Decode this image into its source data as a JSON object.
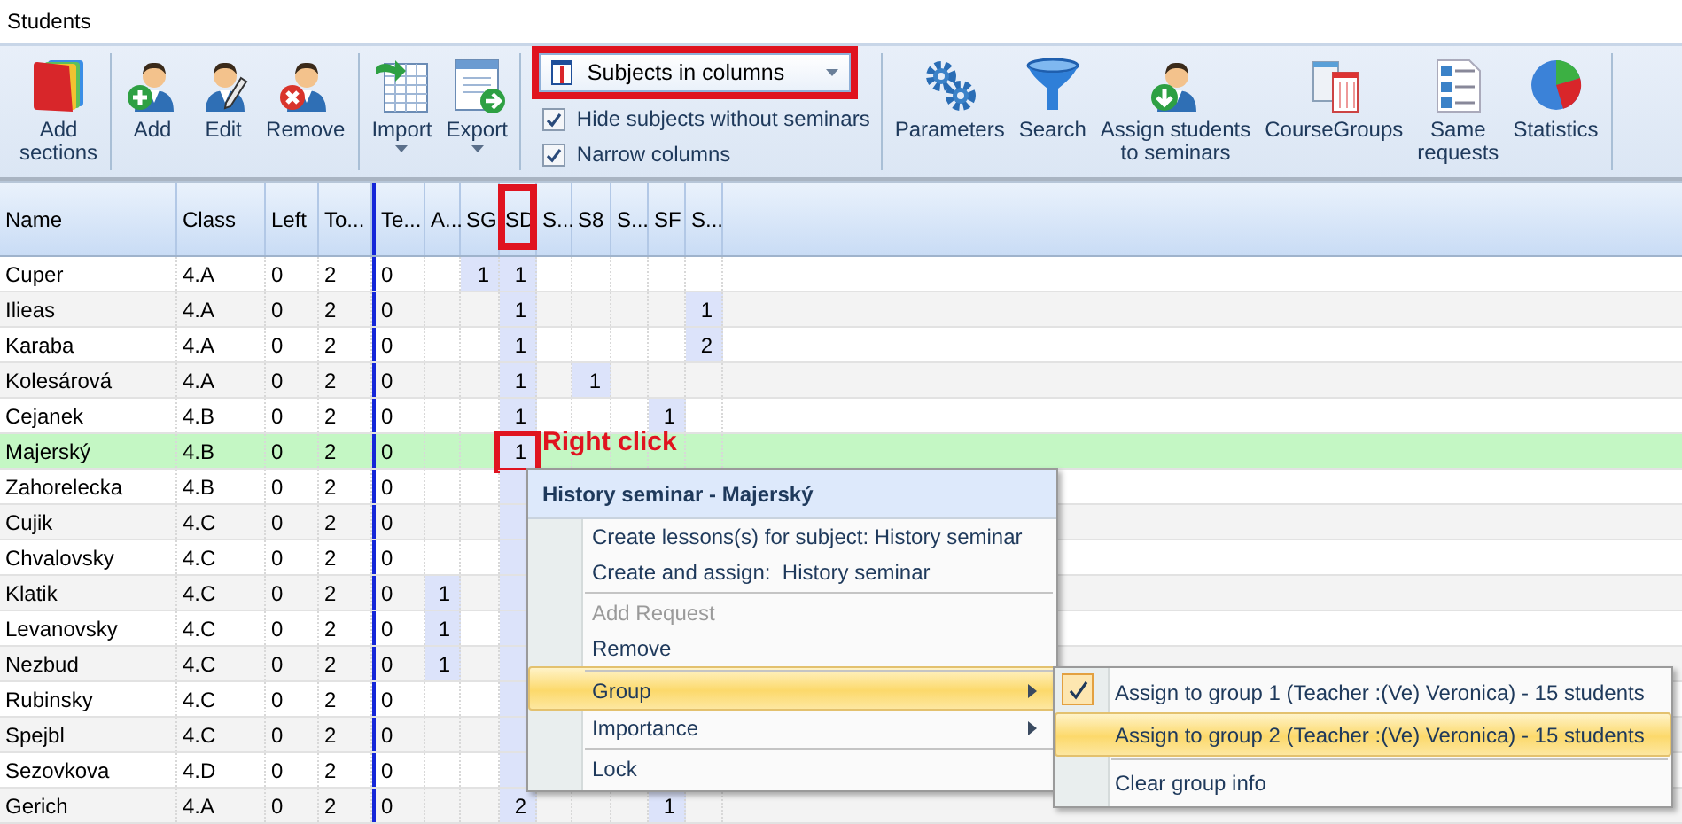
{
  "window": {
    "title": "Students"
  },
  "toolbar": {
    "groups": [
      {
        "buttons": [
          {
            "lines": [
              "Add",
              "sections"
            ],
            "menu": false
          }
        ]
      },
      {
        "buttons": [
          {
            "lines": [
              "Add"
            ],
            "menu": false
          },
          {
            "lines": [
              "Edit"
            ],
            "menu": false
          },
          {
            "lines": [
              "Remove"
            ],
            "menu": false
          }
        ]
      },
      {
        "buttons": [
          {
            "lines": [
              "Import"
            ],
            "menu": true
          },
          {
            "lines": [
              "Export"
            ],
            "menu": true
          }
        ]
      },
      {
        "kind": "view",
        "dropdown": {
          "value": "Subjects in columns",
          "framed": true
        },
        "checkboxes": [
          {
            "label": "Hide subjects without seminars",
            "checked": true
          },
          {
            "label": "Narrow columns",
            "checked": true
          }
        ]
      },
      {
        "buttons": [
          {
            "lines": [
              "Parameters"
            ],
            "menu": false
          },
          {
            "lines": [
              "Search"
            ],
            "menu": false
          },
          {
            "lines": [
              "Assign students",
              "to seminars"
            ],
            "menu": false
          },
          {
            "lines": [
              "CourseGroups"
            ],
            "menu": false
          },
          {
            "lines": [
              "Same",
              "requests"
            ],
            "menu": false
          },
          {
            "lines": [
              "Statistics"
            ],
            "menu": false
          }
        ]
      }
    ]
  },
  "table": {
    "columns": [
      {
        "label": "Name",
        "kind": "info",
        "divider_before": false,
        "selected": false,
        "framed": false
      },
      {
        "label": "Class",
        "kind": "info",
        "divider_before": false,
        "selected": false,
        "framed": false
      },
      {
        "label": "Left",
        "kind": "info",
        "divider_before": false,
        "selected": false,
        "framed": false
      },
      {
        "label": "To...",
        "kind": "info",
        "divider_before": false,
        "selected": false,
        "framed": false
      },
      {
        "label": "Te...",
        "kind": "info",
        "divider_before": true,
        "selected": false,
        "framed": false
      },
      {
        "label": "A...",
        "kind": "seminar",
        "divider_before": false,
        "selected": false,
        "framed": false
      },
      {
        "label": "SG",
        "kind": "seminar",
        "divider_before": false,
        "selected": false,
        "framed": false
      },
      {
        "label": "SD",
        "kind": "seminar",
        "divider_before": false,
        "selected": true,
        "framed": true
      },
      {
        "label": "S...",
        "kind": "seminar",
        "divider_before": false,
        "selected": false,
        "framed": false
      },
      {
        "label": "S8",
        "kind": "seminar",
        "divider_before": false,
        "selected": false,
        "framed": false
      },
      {
        "label": "S...",
        "kind": "seminar",
        "divider_before": false,
        "selected": false,
        "framed": false
      },
      {
        "label": "SF",
        "kind": "seminar",
        "divider_before": false,
        "selected": false,
        "framed": false
      },
      {
        "label": "S...",
        "kind": "seminar",
        "divider_before": false,
        "selected": false,
        "framed": false
      }
    ],
    "rows": [
      {
        "selected": false,
        "framed": false,
        "cells": [
          {
            "text": "Cuper"
          },
          {
            "text": "4.A"
          },
          {
            "text": "0"
          },
          {
            "text": "2"
          },
          {
            "text": "0"
          },
          {},
          {
            "text": "1"
          },
          {
            "text": "1"
          },
          {},
          {},
          {},
          {},
          {}
        ]
      },
      {
        "selected": false,
        "framed": false,
        "cells": [
          {
            "text": "Ilieas"
          },
          {
            "text": "4.A"
          },
          {
            "text": "0"
          },
          {
            "text": "2"
          },
          {
            "text": "0"
          },
          {},
          {},
          {
            "text": "1"
          },
          {},
          {},
          {},
          {},
          {
            "text": "1"
          }
        ]
      },
      {
        "selected": false,
        "framed": false,
        "cells": [
          {
            "text": "Karaba"
          },
          {
            "text": "4.A"
          },
          {
            "text": "0"
          },
          {
            "text": "2"
          },
          {
            "text": "0"
          },
          {},
          {},
          {
            "text": "1"
          },
          {},
          {},
          {},
          {},
          {
            "text": "2"
          }
        ]
      },
      {
        "selected": false,
        "framed": false,
        "cells": [
          {
            "text": "Kolesárová"
          },
          {
            "text": "4.A"
          },
          {
            "text": "0"
          },
          {
            "text": "2"
          },
          {
            "text": "0"
          },
          {},
          {},
          {
            "text": "1"
          },
          {},
          {
            "text": "1"
          },
          {},
          {},
          {}
        ]
      },
      {
        "selected": false,
        "framed": false,
        "cells": [
          {
            "text": "Cejanek"
          },
          {
            "text": "4.B"
          },
          {
            "text": "0"
          },
          {
            "text": "2"
          },
          {
            "text": "0"
          },
          {},
          {},
          {
            "text": "1"
          },
          {},
          {},
          {},
          {
            "text": "1"
          },
          {}
        ]
      },
      {
        "selected": true,
        "framed": true,
        "callout": "Right click",
        "cells": [
          {
            "text": "Majerský"
          },
          {
            "text": "4.B"
          },
          {
            "text": "0"
          },
          {
            "text": "2"
          },
          {
            "text": "0"
          },
          {},
          {},
          {
            "text": "1"
          },
          {},
          {},
          {},
          {},
          {}
        ]
      },
      {
        "selected": false,
        "framed": false,
        "cells": [
          {
            "text": "Zahorelecka"
          },
          {
            "text": "4.B"
          },
          {
            "text": "0"
          },
          {
            "text": "2"
          },
          {
            "text": "0"
          },
          {},
          {},
          {},
          {},
          {},
          {},
          {},
          {}
        ]
      },
      {
        "selected": false,
        "framed": false,
        "cells": [
          {
            "text": "Cujik"
          },
          {
            "text": "4.C"
          },
          {
            "text": "0"
          },
          {
            "text": "2"
          },
          {
            "text": "0"
          },
          {},
          {},
          {},
          {},
          {},
          {},
          {},
          {}
        ]
      },
      {
        "selected": false,
        "framed": false,
        "cells": [
          {
            "text": "Chvalovsky"
          },
          {
            "text": "4.C"
          },
          {
            "text": "0"
          },
          {
            "text": "2"
          },
          {
            "text": "0"
          },
          {},
          {},
          {},
          {},
          {},
          {},
          {},
          {}
        ]
      },
      {
        "selected": false,
        "framed": false,
        "cells": [
          {
            "text": "Klatik"
          },
          {
            "text": "4.C"
          },
          {
            "text": "0"
          },
          {
            "text": "2"
          },
          {
            "text": "0"
          },
          {
            "text": "1"
          },
          {},
          {},
          {},
          {},
          {},
          {},
          {}
        ]
      },
      {
        "selected": false,
        "framed": false,
        "cells": [
          {
            "text": "Levanovsky"
          },
          {
            "text": "4.C"
          },
          {
            "text": "0"
          },
          {
            "text": "2"
          },
          {
            "text": "0"
          },
          {
            "text": "1"
          },
          {},
          {},
          {},
          {},
          {},
          {},
          {}
        ]
      },
      {
        "selected": false,
        "framed": false,
        "cells": [
          {
            "text": "Nezbud"
          },
          {
            "text": "4.C"
          },
          {
            "text": "0"
          },
          {
            "text": "2"
          },
          {
            "text": "0"
          },
          {
            "text": "1"
          },
          {},
          {},
          {},
          {},
          {},
          {},
          {}
        ]
      },
      {
        "selected": false,
        "framed": false,
        "cells": [
          {
            "text": "Rubinsky"
          },
          {
            "text": "4.C"
          },
          {
            "text": "0"
          },
          {
            "text": "2"
          },
          {
            "text": "0"
          },
          {},
          {},
          {},
          {},
          {},
          {},
          {},
          {}
        ]
      },
      {
        "selected": false,
        "framed": false,
        "cells": [
          {
            "text": "Spejbl"
          },
          {
            "text": "4.C"
          },
          {
            "text": "0"
          },
          {
            "text": "2"
          },
          {
            "text": "0"
          },
          {},
          {},
          {},
          {},
          {},
          {},
          {},
          {}
        ]
      },
      {
        "selected": false,
        "framed": false,
        "cells": [
          {
            "text": "Sezovkova"
          },
          {
            "text": "4.D"
          },
          {
            "text": "0"
          },
          {
            "text": "2"
          },
          {
            "text": "0"
          },
          {},
          {},
          {},
          {},
          {},
          {},
          {},
          {}
        ]
      },
      {
        "selected": false,
        "framed": false,
        "cells": [
          {
            "text": "Gerich"
          },
          {
            "text": "4.A"
          },
          {
            "text": "0"
          },
          {
            "text": "2"
          },
          {
            "text": "0"
          },
          {},
          {},
          {
            "text": "2"
          },
          {},
          {},
          {},
          {
            "text": "1"
          },
          {}
        ]
      }
    ]
  },
  "context_menu": {
    "title": "History seminar - Majerský",
    "items": [
      {
        "label": "Create lessons(s) for subject: History seminar",
        "disabled": false,
        "highlighted": false,
        "submenu": false,
        "separator_before": false
      },
      {
        "label": "Create and assign:  History seminar",
        "disabled": false,
        "highlighted": false,
        "submenu": false,
        "separator_before": false
      },
      {
        "label": "Add Request",
        "disabled": true,
        "highlighted": false,
        "submenu": false,
        "separator_before": true
      },
      {
        "label": "Remove",
        "disabled": false,
        "highlighted": false,
        "submenu": false,
        "separator_before": false
      },
      {
        "label": "Group",
        "disabled": false,
        "highlighted": true,
        "submenu": true,
        "separator_before": true
      },
      {
        "label": "Importance",
        "disabled": false,
        "highlighted": false,
        "submenu": true,
        "separator_before": false
      },
      {
        "label": "Lock",
        "disabled": false,
        "highlighted": false,
        "submenu": false,
        "separator_before": true
      }
    ]
  },
  "submenu": {
    "items": [
      {
        "label": "Assign to group 1 (Teacher :(Ve) Veronica) - 15 students",
        "checked": true,
        "highlighted": false,
        "separator_before": false
      },
      {
        "label": "Assign to group 2 (Teacher :(Ve) Veronica) - 15 students",
        "checked": false,
        "highlighted": true,
        "separator_before": false
      },
      {
        "label": "Clear group info",
        "checked": false,
        "highlighted": false,
        "separator_before": true
      }
    ]
  }
}
